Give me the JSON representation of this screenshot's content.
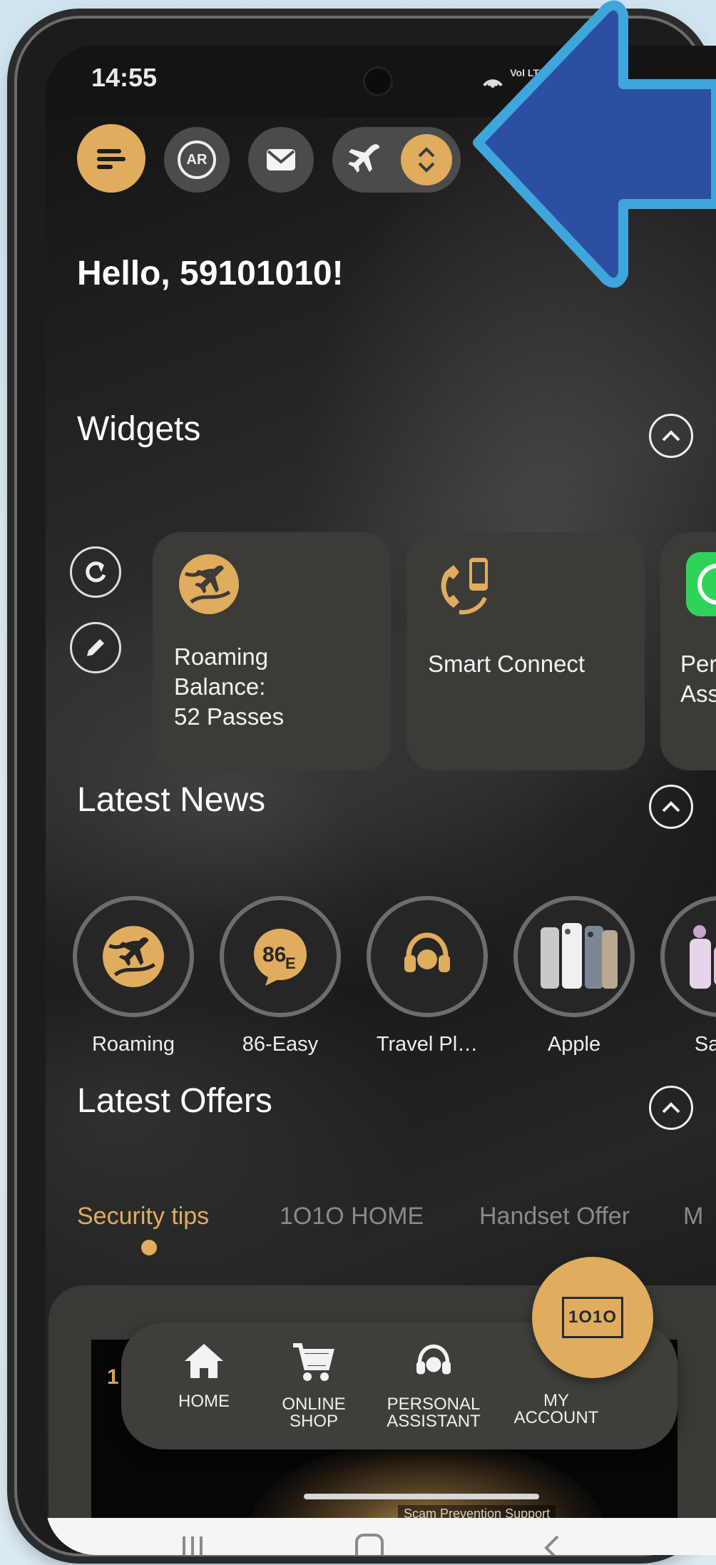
{
  "status_bar": {
    "time": "14:55",
    "icons_text": "Vol LTE"
  },
  "header": {
    "menu_icon": "menu-icon",
    "ar_label": "AR",
    "mail_icon": "mail-icon",
    "travel_icon": "airplane-icon",
    "swap_icon": "swap-vertical-icon"
  },
  "greeting": "Hello, 59101010!",
  "widgets": {
    "title": "Widgets",
    "cards": [
      {
        "label": "Roaming\nBalance:\n52 Passes",
        "icon": "roaming-globe-icon"
      },
      {
        "label": "Smart Connect",
        "icon": "smart-connect-icon"
      },
      {
        "label": "Pers\nAss",
        "icon": "whatsapp-icon"
      }
    ]
  },
  "latest_news": {
    "title": "Latest News",
    "items": [
      {
        "label": "Roaming",
        "icon": "roaming-globe-icon"
      },
      {
        "label": "86-Easy",
        "icon": "86-easy-icon"
      },
      {
        "label": "Travel Pl…",
        "icon": "headset-icon"
      },
      {
        "label": "Apple",
        "icon": "phones-image"
      },
      {
        "label": "Sams",
        "icon": "foldable-phone-image"
      }
    ]
  },
  "latest_offers": {
    "title": "Latest Offers",
    "tabs": [
      {
        "label": "Security tips",
        "active": true
      },
      {
        "label": "1O1O HOME",
        "active": false
      },
      {
        "label": "Handset Offer",
        "active": false
      },
      {
        "label": "M",
        "active": false
      }
    ],
    "banner": {
      "mark": "1",
      "caption": "Scam Prevention Support"
    }
  },
  "bottom_nav": [
    {
      "label": "HOME",
      "icon": "home-icon"
    },
    {
      "label": "ONLINE\nSHOP",
      "icon": "cart-icon"
    },
    {
      "label": "PERSONAL\nASSISTANT",
      "icon": "headset-icon"
    },
    {
      "label": "MY\nACCOUNT",
      "icon": "1o1o-logo"
    }
  ],
  "account_logo": "1O1O",
  "colors": {
    "accent": "#e0ad5e",
    "card": "#3c3b38",
    "arrow": "#2c4ea3",
    "arrow_outline": "#3fa6dc"
  }
}
